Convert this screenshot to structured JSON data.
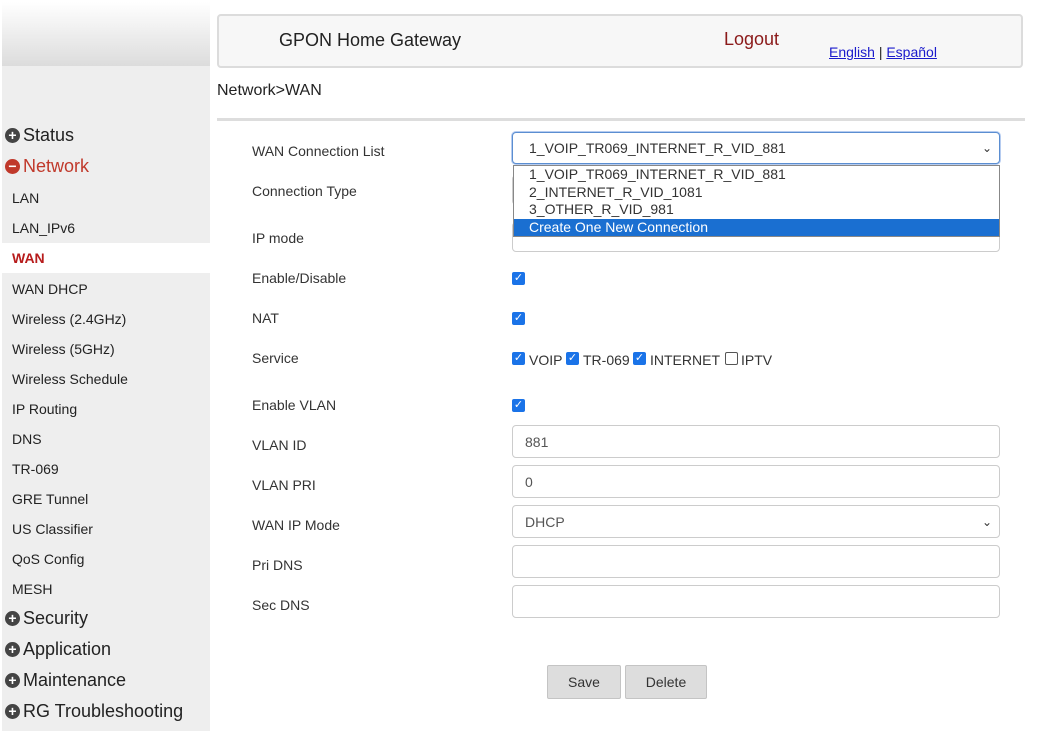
{
  "header": {
    "title": "GPON Home Gateway",
    "logout": "Logout",
    "lang_en": "English",
    "lang_sep": "|",
    "lang_es": "Español"
  },
  "sidebar": {
    "groups": [
      {
        "label": "Status"
      },
      {
        "label": "Network"
      },
      {
        "label": "Security"
      },
      {
        "label": "Application"
      },
      {
        "label": "Maintenance"
      },
      {
        "label": "RG Troubleshooting"
      }
    ],
    "network_items": [
      "LAN",
      "LAN_IPv6",
      "WAN",
      "WAN DHCP",
      "Wireless (2.4GHz)",
      "Wireless (5GHz)",
      "Wireless Schedule",
      "IP Routing",
      "DNS",
      "TR-069",
      "GRE Tunnel",
      "US Classifier",
      "QoS Config",
      "MESH"
    ]
  },
  "breadcrumb": "Network>WAN",
  "form": {
    "wan_connection_list": {
      "label": "WAN Connection List",
      "value": "1_VOIP_TR069_INTERNET_R_VID_881",
      "options": [
        "1_VOIP_TR069_INTERNET_R_VID_881",
        "2_INTERNET_R_VID_1081",
        "3_OTHER_R_VID_981",
        "Create One New Connection"
      ]
    },
    "connection_type": {
      "label": "Connection Type"
    },
    "ip_mode": {
      "label": "IP mode"
    },
    "enable": {
      "label": "Enable/Disable",
      "checked": true
    },
    "nat": {
      "label": "NAT",
      "checked": true
    },
    "service": {
      "label": "Service",
      "options": [
        {
          "label": "VOIP",
          "checked": true
        },
        {
          "label": "TR-069",
          "checked": true
        },
        {
          "label": "INTERNET",
          "checked": true
        },
        {
          "label": "IPTV",
          "checked": false
        }
      ]
    },
    "enable_vlan": {
      "label": "Enable VLAN",
      "checked": true
    },
    "vlan_id": {
      "label": "VLAN ID",
      "value": "881"
    },
    "vlan_pri": {
      "label": "VLAN PRI",
      "value": "0"
    },
    "wan_ip_mode": {
      "label": "WAN IP Mode",
      "value": "DHCP"
    },
    "pri_dns": {
      "label": "Pri DNS",
      "value": ""
    },
    "sec_dns": {
      "label": "Sec DNS",
      "value": ""
    }
  },
  "buttons": {
    "save": "Save",
    "delete": "Delete"
  },
  "colors": {
    "accent_red": "#c0392b",
    "selection_blue": "#1a6fd1",
    "checkbox_blue": "#1a73e8"
  }
}
